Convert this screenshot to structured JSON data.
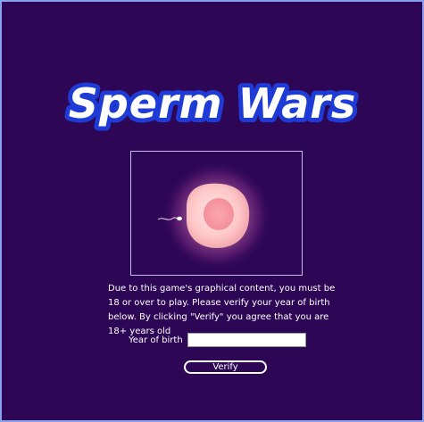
{
  "game": {
    "title": "Sperm Wars"
  },
  "age_gate": {
    "notice": "Due to this game's graphical content, you must be 18 or over to play. Please verify your year of birth below. By clicking \"Verify\" you agree that you are 18+ years old",
    "year_label": "Year of birth",
    "year_value": "",
    "verify_label": "Verify"
  },
  "colors": {
    "background": "#2e0656",
    "border": "#8aa0ee",
    "logo_fill": "#ffffff",
    "logo_outline": "#1f3bd6"
  }
}
